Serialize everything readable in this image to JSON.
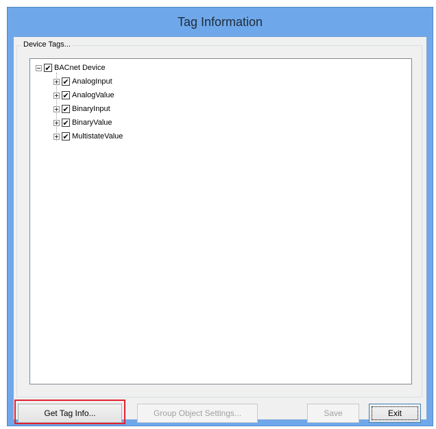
{
  "window": {
    "title": "Tag Information"
  },
  "group": {
    "label": "Device Tags..."
  },
  "tree": {
    "root": {
      "label": "BACnet Device",
      "checked": true,
      "expanded": true
    },
    "children": [
      {
        "label": "AnalogInput",
        "checked": true,
        "expanded": false
      },
      {
        "label": "AnalogValue",
        "checked": true,
        "expanded": false
      },
      {
        "label": "BinaryInput",
        "checked": true,
        "expanded": false
      },
      {
        "label": "BinaryValue",
        "checked": true,
        "expanded": false
      },
      {
        "label": "MultistateValue",
        "checked": true,
        "expanded": false
      }
    ]
  },
  "buttons": {
    "get_tag_info": "Get Tag Info...",
    "group_object_settings": "Group Object Settings...",
    "save": "Save",
    "exit": "Exit"
  },
  "colors": {
    "titlebar": "#6fa8ea",
    "highlight": "#e4202e"
  }
}
